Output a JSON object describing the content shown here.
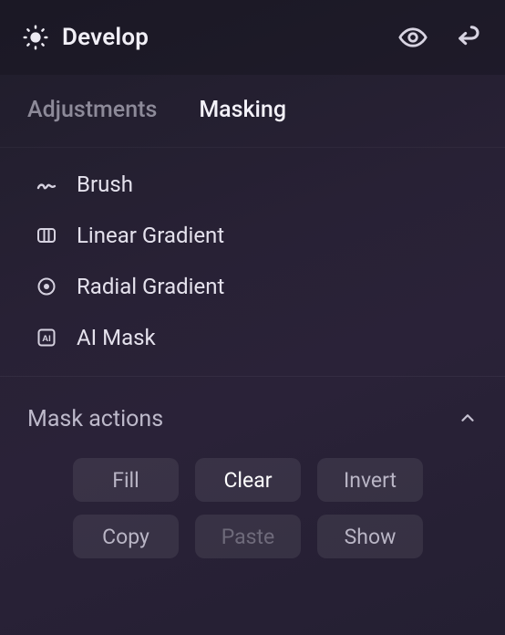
{
  "header": {
    "title": "Develop"
  },
  "tabs": {
    "adjustments": "Adjustments",
    "masking": "Masking"
  },
  "mask_types": {
    "brush": "Brush",
    "linear": "Linear Gradient",
    "radial": "Radial Gradient",
    "ai": "AI Mask"
  },
  "mask_actions_section": {
    "title": "Mask actions"
  },
  "mask_actions": {
    "fill": "Fill",
    "clear": "Clear",
    "invert": "Invert",
    "copy": "Copy",
    "paste": "Paste",
    "show": "Show"
  }
}
